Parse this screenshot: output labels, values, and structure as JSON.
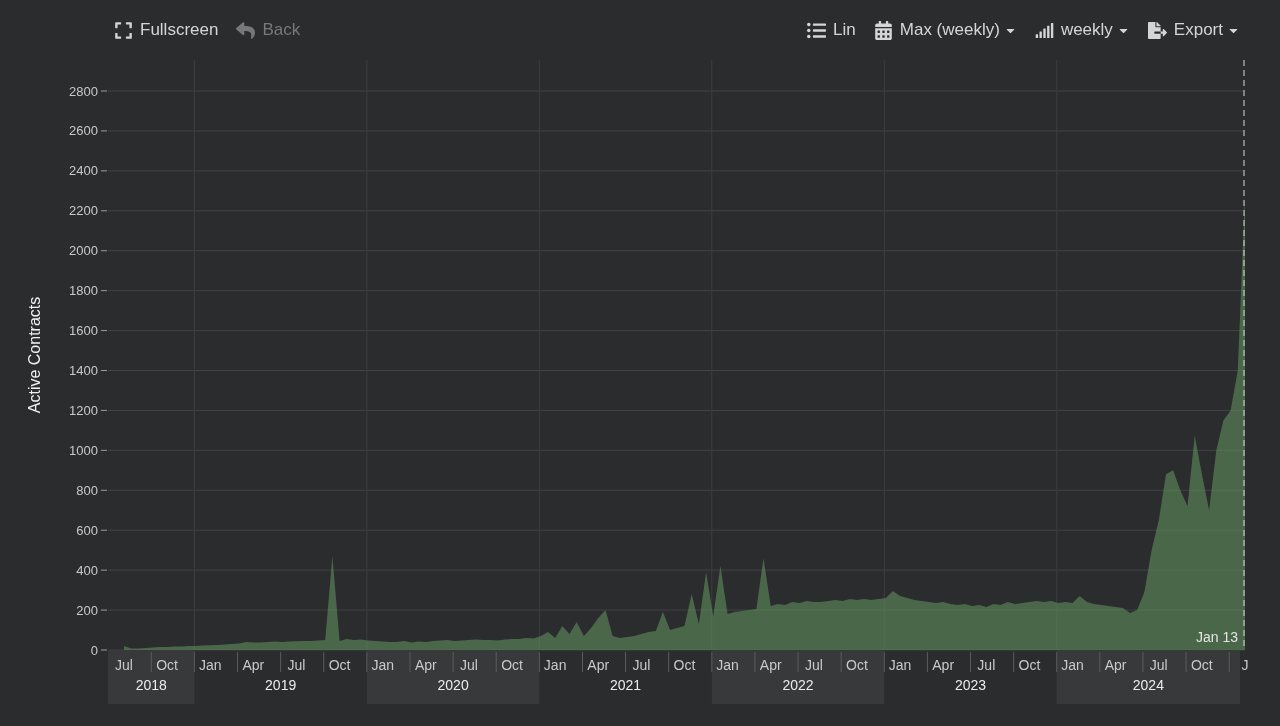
{
  "toolbar": {
    "left": [
      {
        "kind": "fullscreen",
        "label": "Fullscreen",
        "disabled": false,
        "has_menu": false
      },
      {
        "kind": "back",
        "label": "Back",
        "disabled": true,
        "has_menu": false
      }
    ],
    "right": [
      {
        "kind": "scale",
        "label": "Lin",
        "disabled": false,
        "has_menu": false
      },
      {
        "kind": "range",
        "label": "Max (weekly)",
        "disabled": false,
        "has_menu": true
      },
      {
        "kind": "interval",
        "label": "weekly",
        "disabled": false,
        "has_menu": true
      },
      {
        "kind": "export",
        "label": "Export",
        "disabled": false,
        "has_menu": true
      }
    ]
  },
  "chart": {
    "year_bands": [
      {
        "label": "2018",
        "shaded": true
      },
      {
        "label": "2019",
        "shaded": false
      },
      {
        "label": "2020",
        "shaded": true
      },
      {
        "label": "2021",
        "shaded": false
      },
      {
        "label": "2022",
        "shaded": true
      },
      {
        "label": "2023",
        "shaded": false
      },
      {
        "label": "2024",
        "shaded": true
      }
    ],
    "chart_data": {
      "type": "area",
      "ylabel": "Active Contracts",
      "categories": [
        "Jul",
        null,
        null,
        null,
        null,
        null,
        "Oct",
        null,
        null,
        null,
        null,
        null,
        "Jan",
        null,
        null,
        null,
        null,
        null,
        "Apr",
        null,
        null,
        null,
        null,
        null,
        "Jul",
        null,
        null,
        null,
        null,
        null,
        "Oct",
        null,
        null,
        null,
        null,
        null,
        "Jan",
        null,
        null,
        null,
        null,
        null,
        "Apr",
        null,
        null,
        null,
        null,
        null,
        "Jul",
        null,
        null,
        null,
        null,
        null,
        "Oct",
        null,
        null,
        null,
        null,
        null,
        "Jan",
        null,
        null,
        null,
        null,
        null,
        "Apr",
        null,
        null,
        null,
        null,
        null,
        "Jul",
        null,
        null,
        null,
        null,
        null,
        "Oct",
        null,
        null,
        null,
        null,
        null,
        "Jan",
        null,
        null,
        null,
        null,
        null,
        "Apr",
        null,
        null,
        null,
        null,
        null,
        "Jul",
        null,
        null,
        null,
        null,
        null,
        "Oct",
        null,
        null,
        null,
        null,
        null,
        "Jan",
        null,
        null,
        null,
        null,
        null,
        "Apr",
        null,
        null,
        null,
        null,
        null,
        "Jul",
        null,
        null,
        null,
        null,
        null,
        "Oct",
        null,
        null,
        null,
        null,
        null,
        "Jan",
        null,
        null,
        null,
        null,
        null,
        "Apr",
        null,
        null,
        null,
        null,
        null,
        "Jul",
        null,
        null,
        null,
        null,
        null,
        "Oct",
        null,
        null,
        null,
        null,
        null,
        "J"
      ],
      "series": [
        {
          "color": "#5f8f5c",
          "values": [
            20,
            8,
            8,
            10,
            12,
            15,
            15,
            18,
            18,
            20,
            20,
            22,
            24,
            25,
            27,
            30,
            32,
            40,
            38,
            38,
            40,
            42,
            40,
            42,
            44,
            45,
            45,
            48,
            50,
            470,
            45,
            55,
            50,
            52,
            48,
            45,
            42,
            40,
            40,
            45,
            38,
            42,
            40,
            45,
            48,
            50,
            45,
            48,
            50,
            52,
            50,
            50,
            48,
            52,
            55,
            55,
            60,
            58,
            70,
            90,
            60,
            120,
            80,
            140,
            70,
            110,
            160,
            200,
            70,
            60,
            65,
            70,
            80,
            90,
            95,
            190,
            100,
            110,
            120,
            280,
            130,
            390,
            170,
            420,
            180,
            190,
            195,
            200,
            205,
            460,
            220,
            230,
            225,
            240,
            235,
            245,
            240,
            240,
            245,
            250,
            245,
            255,
            250,
            255,
            250,
            255,
            260,
            295,
            270,
            260,
            250,
            245,
            240,
            235,
            240,
            230,
            225,
            230,
            220,
            225,
            215,
            230,
            225,
            240,
            230,
            235,
            240,
            245,
            240,
            245,
            235,
            240,
            235,
            270,
            240,
            230,
            225,
            220,
            215,
            210,
            185,
            200,
            290,
            500,
            650,
            880,
            900,
            800,
            720,
            1075,
            880,
            700,
            1000,
            1150,
            1200,
            1400,
            2280
          ]
        }
      ],
      "ylim": [
        0,
        2800
      ],
      "grid": true,
      "yticks": [
        0,
        200,
        400,
        600,
        800,
        1000,
        1200,
        1400,
        1600,
        1800,
        2000,
        2200,
        2400,
        2600,
        2800
      ],
      "annotations": [
        "Jan 13"
      ]
    }
  }
}
